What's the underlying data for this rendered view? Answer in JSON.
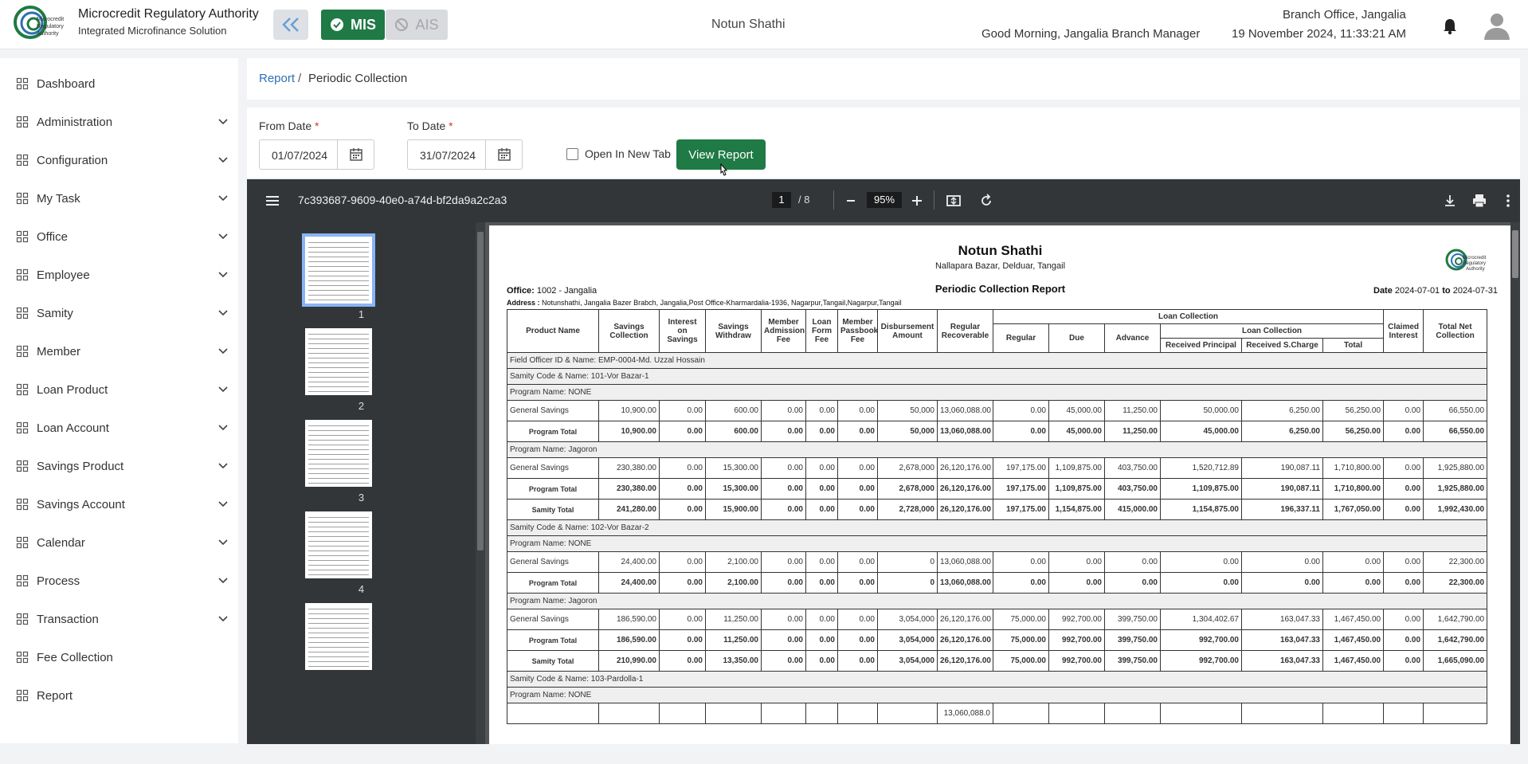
{
  "header": {
    "brand_title": "Microcredit Regulatory Authority",
    "brand_subtitle": "Integrated Microfinance Solution",
    "logo_text": "Microcredit Regulatory Authority",
    "mis_label": "MIS",
    "ais_label": "AIS",
    "center_title": "Notun Shathi",
    "greeting": "Good Morning, Jangalia Branch Manager",
    "branch": "Branch Office, Jangalia",
    "datetime": "19 November 2024, 11:33:21 AM"
  },
  "sidebar": {
    "items": [
      {
        "label": "Dashboard",
        "icon": "dashboard-icon",
        "chevron": false
      },
      {
        "label": "Administration",
        "icon": "admin-icon",
        "chevron": true
      },
      {
        "label": "Configuration",
        "icon": "config-icon",
        "chevron": true
      },
      {
        "label": "My Task",
        "icon": "task-icon",
        "chevron": true
      },
      {
        "label": "Office",
        "icon": "office-icon",
        "chevron": true
      },
      {
        "label": "Employee",
        "icon": "employee-icon",
        "chevron": true
      },
      {
        "label": "Samity",
        "icon": "samity-icon",
        "chevron": true
      },
      {
        "label": "Member",
        "icon": "member-icon",
        "chevron": true
      },
      {
        "label": "Loan Product",
        "icon": "loan-product-icon",
        "chevron": true
      },
      {
        "label": "Loan Account",
        "icon": "loan-account-icon",
        "chevron": true
      },
      {
        "label": "Savings Product",
        "icon": "savings-product-icon",
        "chevron": true
      },
      {
        "label": "Savings Account",
        "icon": "savings-account-icon",
        "chevron": true
      },
      {
        "label": "Calendar",
        "icon": "calendar-icon",
        "chevron": true
      },
      {
        "label": "Process",
        "icon": "process-icon",
        "chevron": true
      },
      {
        "label": "Transaction",
        "icon": "transaction-icon",
        "chevron": true
      },
      {
        "label": "Fee Collection",
        "icon": "fee-icon",
        "chevron": false
      },
      {
        "label": "Report",
        "icon": "report-icon",
        "chevron": false
      }
    ]
  },
  "breadcrumb": {
    "link": "Report",
    "separator": "/",
    "current": "Periodic Collection"
  },
  "filters": {
    "from_label": "From Date",
    "from_value": "01/07/2024",
    "to_label": "To Date",
    "to_value": "31/07/2024",
    "required_mark": "*",
    "open_new_tab_label": "Open In New Tab",
    "view_button": "View Report"
  },
  "viewer": {
    "doc_title": "7c393687-9609-40e0-a74d-bf2da9a2c2a3",
    "current_page": "1",
    "total_pages": "/ 8",
    "zoom": "95%",
    "thumbnails": [
      "1",
      "2",
      "3",
      "4"
    ]
  },
  "report": {
    "title": "Notun Shathi",
    "address_line": "Nallapara Bazar, Delduar, Tangail",
    "logo_text": "Microcredit Regulatory Authority",
    "office_label": "Office:",
    "office_value": "1002 - Jangalia",
    "subtitle": "Periodic Collection Report",
    "date_label": "Date",
    "date_from": "2024-07-01",
    "date_to_label": "to",
    "date_to": "2024-07-31",
    "address_label": "Address :",
    "address_value": "Notunshathi, Jangalia Bazer Brabch, Jangalia,Post Office-Kharmardalia-1936, Nagarpur,Tangail,Nagarpur,Tangail",
    "headers": {
      "product_name": "Product Name",
      "savings_collection": "Savings Collection",
      "interest_on_savings": "Interest on Savings",
      "savings_withdraw": "Savings Withdraw",
      "member_admission_fee": "Member Admission Fee",
      "loan_form_fee": "Loan Form Fee",
      "member_passbook_fee": "Member Passbook Fee",
      "disbursement_amount": "Disbursement Amount",
      "regular_recoverable": "Regular Recoverable",
      "loan_collection": "Loan Collection",
      "regular": "Regular",
      "due": "Due",
      "advance": "Advance",
      "loan_collection_sub": "Loan Collection",
      "received_principal": "Received Principal",
      "received_scharge": "Received S.Charge",
      "total": "Total",
      "claimed_interest": "Claimed Interest",
      "total_net_collection": "Total Net Collection"
    },
    "rows": [
      {
        "type": "grp",
        "text": "Field Officer ID & Name: EMP-0004-Md. Uzzal Hossain"
      },
      {
        "type": "grp",
        "text": "Samity Code & Name: 101-Vor Bazar-1"
      },
      {
        "type": "grp",
        "text": "Program Name: NONE"
      },
      {
        "type": "data",
        "cells": [
          "General Savings",
          "10,900.00",
          "0.00",
          "600.00",
          "0.00",
          "0.00",
          "0.00",
          "50,000",
          "13,060,088.00",
          "0.00",
          "45,000.00",
          "11,250.00",
          "50,000.00",
          "6,250.00",
          "56,250.00",
          "0.00",
          "66,550.00"
        ]
      },
      {
        "type": "tot",
        "cells": [
          "Program Total",
          "10,900.00",
          "0.00",
          "600.00",
          "0.00",
          "0.00",
          "0.00",
          "50,000",
          "13,060,088.00",
          "0.00",
          "45,000.00",
          "11,250.00",
          "45,000.00",
          "6,250.00",
          "56,250.00",
          "0.00",
          "66,550.00"
        ]
      },
      {
        "type": "grp",
        "text": "Program Name: Jagoron"
      },
      {
        "type": "data",
        "cells": [
          "General Savings",
          "230,380.00",
          "0.00",
          "15,300.00",
          "0.00",
          "0.00",
          "0.00",
          "2,678,000",
          "26,120,176.00",
          "197,175.00",
          "1,109,875.00",
          "403,750.00",
          "1,520,712.89",
          "190,087.11",
          "1,710,800.00",
          "0.00",
          "1,925,880.00"
        ]
      },
      {
        "type": "tot",
        "cells": [
          "Program Total",
          "230,380.00",
          "0.00",
          "15,300.00",
          "0.00",
          "0.00",
          "0.00",
          "2,678,000",
          "26,120,176.00",
          "197,175.00",
          "1,109,875.00",
          "403,750.00",
          "1,109,875.00",
          "190,087.11",
          "1,710,800.00",
          "0.00",
          "1,925,880.00"
        ]
      },
      {
        "type": "tot",
        "cells": [
          "Samity Total",
          "241,280.00",
          "0.00",
          "15,900.00",
          "0.00",
          "0.00",
          "0.00",
          "2,728,000",
          "26,120,176.00",
          "197,175.00",
          "1,154,875.00",
          "415,000.00",
          "1,154,875.00",
          "196,337.11",
          "1,767,050.00",
          "0.00",
          "1,992,430.00"
        ]
      },
      {
        "type": "grp",
        "text": "Samity Code & Name: 102-Vor Bazar-2"
      },
      {
        "type": "grp",
        "text": "Program Name: NONE"
      },
      {
        "type": "data",
        "cells": [
          "General Savings",
          "24,400.00",
          "0.00",
          "2,100.00",
          "0.00",
          "0.00",
          "0.00",
          "0",
          "13,060,088.00",
          "0.00",
          "0.00",
          "0.00",
          "0.00",
          "0.00",
          "0.00",
          "0.00",
          "22,300.00"
        ]
      },
      {
        "type": "tot",
        "cells": [
          "Program Total",
          "24,400.00",
          "0.00",
          "2,100.00",
          "0.00",
          "0.00",
          "0.00",
          "0",
          "13,060,088.00",
          "0.00",
          "0.00",
          "0.00",
          "0.00",
          "0.00",
          "0.00",
          "0.00",
          "22,300.00"
        ]
      },
      {
        "type": "grp",
        "text": "Program Name: Jagoron"
      },
      {
        "type": "data",
        "cells": [
          "General Savings",
          "186,590.00",
          "0.00",
          "11,250.00",
          "0.00",
          "0.00",
          "0.00",
          "3,054,000",
          "26,120,176.00",
          "75,000.00",
          "992,700.00",
          "399,750.00",
          "1,304,402.67",
          "163,047.33",
          "1,467,450.00",
          "0.00",
          "1,642,790.00"
        ]
      },
      {
        "type": "tot",
        "cells": [
          "Program Total",
          "186,590.00",
          "0.00",
          "11,250.00",
          "0.00",
          "0.00",
          "0.00",
          "3,054,000",
          "26,120,176.00",
          "75,000.00",
          "992,700.00",
          "399,750.00",
          "992,700.00",
          "163,047.33",
          "1,467,450.00",
          "0.00",
          "1,642,790.00"
        ]
      },
      {
        "type": "tot",
        "cells": [
          "Samity Total",
          "210,990.00",
          "0.00",
          "13,350.00",
          "0.00",
          "0.00",
          "0.00",
          "3,054,000",
          "26,120,176.00",
          "75,000.00",
          "992,700.00",
          "399,750.00",
          "992,700.00",
          "163,047.33",
          "1,467,450.00",
          "0.00",
          "1,665,090.00"
        ]
      },
      {
        "type": "grp",
        "text": "Samity Code & Name: 103-Pardolla-1"
      },
      {
        "type": "grp",
        "text": "Program Name: NONE"
      },
      {
        "type": "data",
        "cells": [
          "",
          "",
          "",
          "",
          "",
          "",
          "",
          "",
          "13,060,088.0",
          "",
          "",
          "",
          "",
          "",
          "",
          "",
          ""
        ]
      }
    ]
  }
}
